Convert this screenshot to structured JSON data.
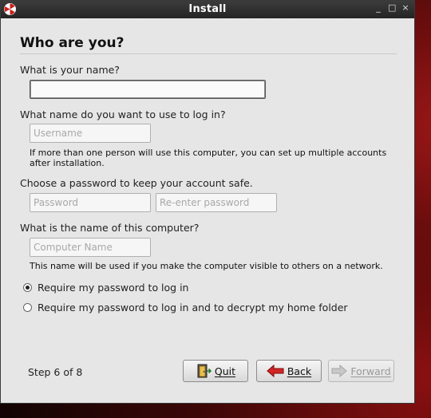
{
  "window": {
    "title": "Install",
    "controls": {
      "minimize": "_",
      "maximize": "□",
      "close": "×"
    }
  },
  "page": {
    "heading": "Who are you?"
  },
  "name_section": {
    "label": "What is your name?",
    "value": ""
  },
  "login_section": {
    "label": "What name do you want to use to log in?",
    "placeholder": "Username",
    "hint": "If more than one person will use this computer, you can set up multiple accounts after installation."
  },
  "password_section": {
    "label": "Choose a password to keep your account safe.",
    "password_placeholder": "Password",
    "reenter_placeholder": "Re-enter password"
  },
  "computer_section": {
    "label": "What is the name of this computer?",
    "placeholder": "Computer Name",
    "hint": "This name will be used if you make the computer visible to others on a network."
  },
  "login_options": [
    {
      "label": "Require my password to log in",
      "selected": true
    },
    {
      "label": "Require my password to log in and to decrypt my home folder",
      "selected": false
    }
  ],
  "footer": {
    "step": "Step 6 of 8",
    "quit": "Quit",
    "back": "Back",
    "forward": "Forward"
  },
  "colors": {
    "accent_red": "#c9211e",
    "window_bg": "#e6e6e6",
    "titlebar": "#2e2e2e"
  }
}
